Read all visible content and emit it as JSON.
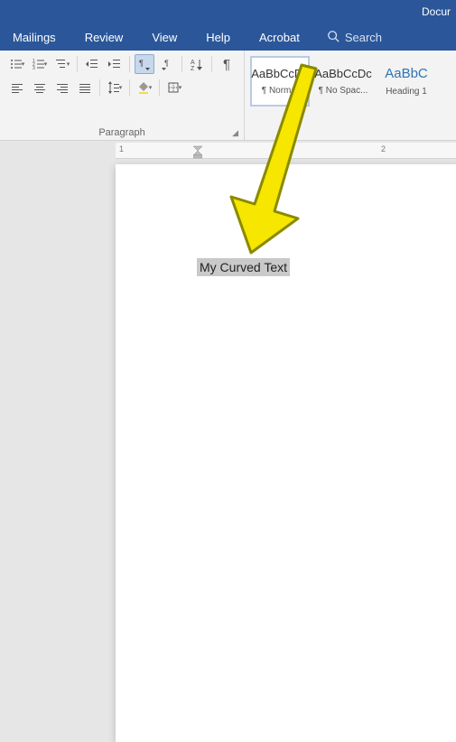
{
  "titlebar": {
    "doc_title_fragment": "Docur"
  },
  "tabs": {
    "mailings": "Mailings",
    "review": "Review",
    "view": "View",
    "help": "Help",
    "acrobat": "Acrobat"
  },
  "search": {
    "placeholder": "Search"
  },
  "paragraph": {
    "group_label": "Paragraph",
    "bullets": "bullets",
    "numbering": "numbering",
    "multilevel": "multilevel",
    "dec_indent": "decrease-indent",
    "inc_indent": "increase-indent",
    "ltr": "ltr",
    "rtl": "rtl",
    "sort": "sort",
    "show_marks": "¶",
    "align_left": "align-left",
    "align_center": "align-center",
    "align_right": "align-right",
    "align_justify": "align-justify",
    "line_spacing": "line-spacing",
    "shading": "shading",
    "borders": "borders"
  },
  "styles": {
    "preview_sample": "AaBbCcDc",
    "preview_sample_heading": "AaBbC",
    "items": [
      {
        "name": "¶ Normal"
      },
      {
        "name": "¶ No Spac..."
      },
      {
        "name": "Heading 1"
      }
    ]
  },
  "ruler": {
    "marks": [
      "1",
      "2"
    ]
  },
  "document": {
    "selected_text": "My Curved Text"
  },
  "colors": {
    "brand": "#2b579a",
    "ribbon_bg": "#f3f3f3",
    "canvas": "#e6e6e6",
    "arrow": "#f6e600",
    "arrow_stroke": "#8a8a00",
    "heading_link": "#2e74b5"
  }
}
